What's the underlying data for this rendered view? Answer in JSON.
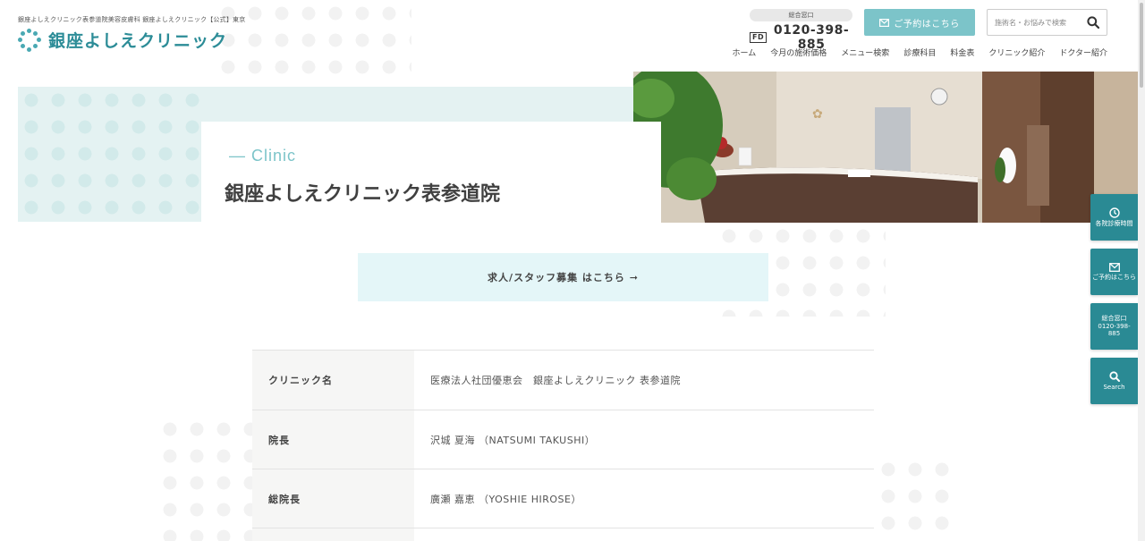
{
  "header": {
    "tagline": "銀座よしえクリニック表参道院美容皮膚科 銀座よしえクリニック【公式】東京",
    "logo_text": "銀座よしえクリニック",
    "phone": {
      "badge": "総合窓口",
      "freedial_label": "FD",
      "number": "0120-398-885"
    },
    "reserve_button": "ご予約はこちら",
    "search_placeholder": "施術名・お悩みで検索"
  },
  "nav": {
    "items": [
      "ホーム",
      "今月の施術価格",
      "メニュー検索",
      "診療科目",
      "料金表",
      "クリニック紹介",
      "ドクター紹介"
    ]
  },
  "hero": {
    "eyebrow": "— Clinic",
    "title": "銀座よしえクリニック表参道院"
  },
  "recruit": {
    "label": "求人/スタッフ募集 はこちら ➞"
  },
  "clinic_info": {
    "rows": [
      {
        "label": "クリニック名",
        "value": "医療法人社団優恵会　銀座よしえクリニック 表参道院"
      },
      {
        "label": "院長",
        "value": "沢城 夏海 （NATSUMI TAKUSHI）"
      },
      {
        "label": "総院長",
        "value": "廣瀬 嘉恵 （YOSHIE HIROSE）"
      }
    ]
  },
  "side_buttons": [
    {
      "icon": "clock-icon",
      "label": "各院診療時間"
    },
    {
      "icon": "mail-icon",
      "label": "ご予約はこちら"
    },
    {
      "icon": "phone-icon",
      "label": "総合窓口 0120-398-885"
    },
    {
      "icon": "search-icon",
      "label": "Search"
    }
  ],
  "colors": {
    "accent": "#7cc4c9",
    "brand": "#2c8c97",
    "side_button": "#2a8a94",
    "hero_band": "#e4f2f2",
    "recruit_bg": "#e4f6f8"
  }
}
